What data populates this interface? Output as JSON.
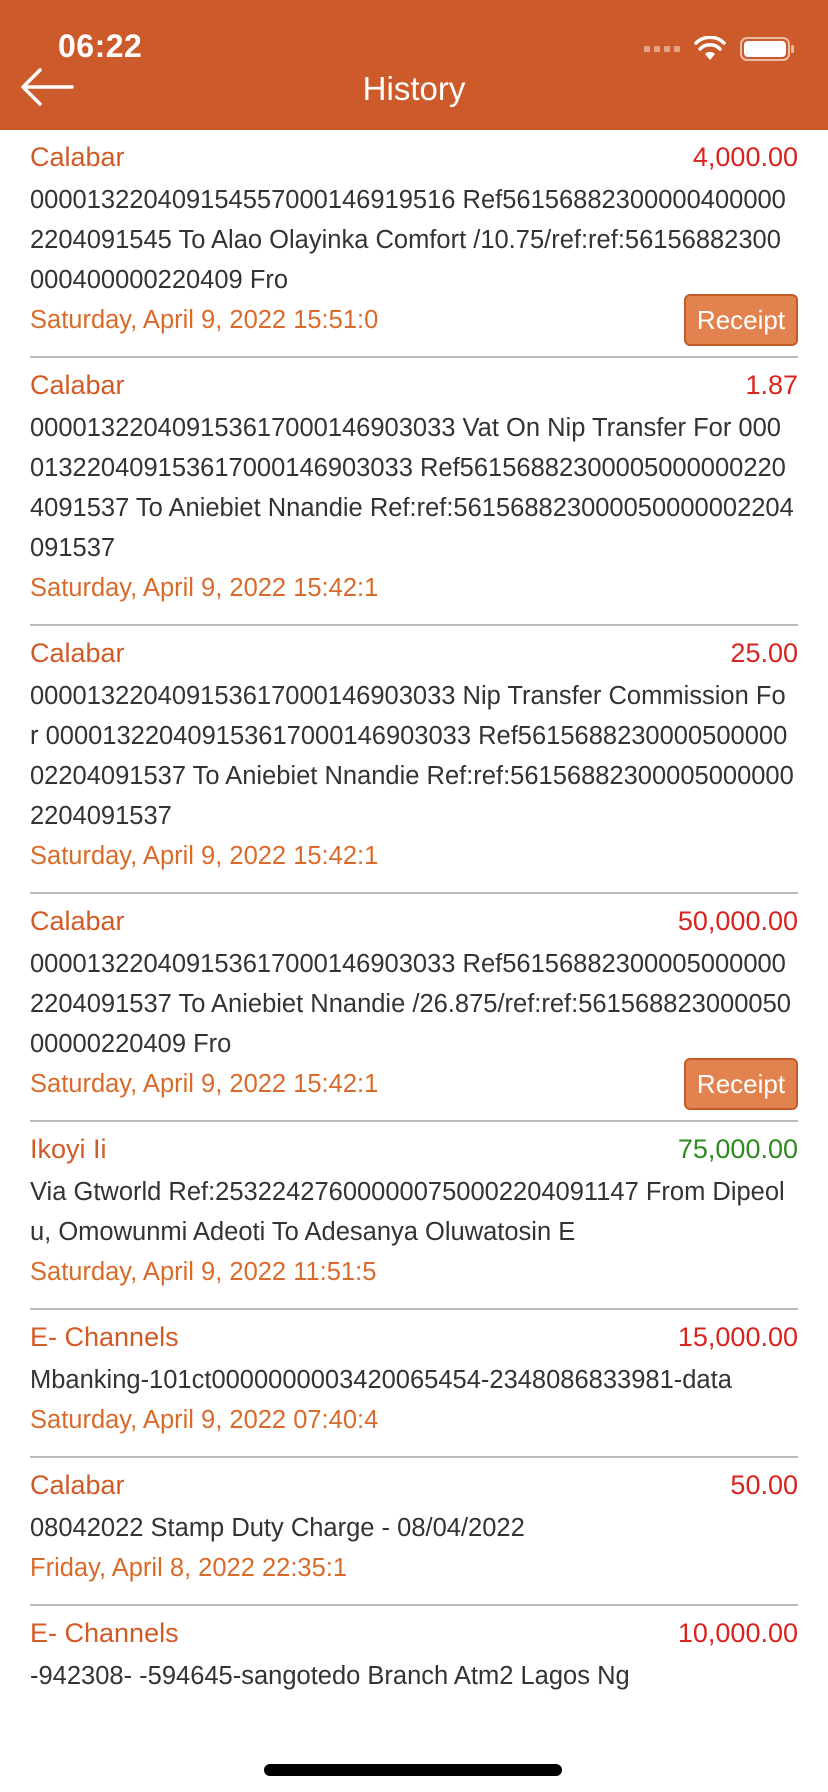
{
  "status_bar": {
    "time": "06:22"
  },
  "header": {
    "title": "History"
  },
  "colors": {
    "header_bg": "#cd5a2a",
    "branch": "#d25a25",
    "debit": "#d8241f",
    "credit": "#2e8a1e",
    "date": "#d96b2a",
    "receipt_bg": "#e2824e"
  },
  "transactions": [
    {
      "branch": "Calabar",
      "amount": "4,000.00",
      "type": "debit",
      "description": "000013220409154557000146919516 Ref561568823000004000002204091545 To Alao Olayinka Comfort /10.75/ref:ref:56156882300000400000220409 Fro",
      "date": "Saturday, April 9, 2022 15:51:0",
      "receipt_label": "Receipt"
    },
    {
      "branch": "Calabar",
      "amount": "1.87",
      "type": "debit",
      "description": "000013220409153617000146903033 Vat On Nip Transfer For 000013220409153617000146903033 Ref561568823000050000002204091537 To Aniebiet Nnandie Ref:ref:561568823000050000002204091537",
      "date": "Saturday, April 9, 2022 15:42:1"
    },
    {
      "branch": "Calabar",
      "amount": "25.00",
      "type": "debit",
      "description": "000013220409153617000146903033 Nip Transfer Commission For 000013220409153617000146903033 Ref561568823000050000002204091537 To Aniebiet Nnandie Ref:ref:561568823000050000002204091537",
      "date": "Saturday, April 9, 2022 15:42:1"
    },
    {
      "branch": "Calabar",
      "amount": "50,000.00",
      "type": "debit",
      "description": "000013220409153617000146903033 Ref561568823000050000002204091537 To Aniebiet Nnandie /26.875/ref:ref:56156882300005000000220409 Fro",
      "date": "Saturday, April 9, 2022 15:42:1",
      "receipt_label": "Receipt"
    },
    {
      "branch": "Ikoyi Ii",
      "amount": "75,000.00",
      "type": "credit",
      "description": "Via Gtworld Ref:253224276000000750002204091147 From Dipeolu, Omowunmi Adeoti To Adesanya Oluwatosin E",
      "date": "Saturday, April 9, 2022 11:51:5"
    },
    {
      "branch": "E- Channels",
      "amount": "15,000.00",
      "type": "debit",
      "description": "Mbanking-101ct000000000342006545­4-2348086833981-data",
      "date": "Saturday, April 9, 2022 07:40:4"
    },
    {
      "branch": "Calabar",
      "amount": "50.00",
      "type": "debit",
      "description": "08042022 Stamp Duty Charge - 08/04/2022",
      "date": "Friday, April 8, 2022 22:35:1"
    },
    {
      "branch": "E- Channels",
      "amount": "10,000.00",
      "type": "debit",
      "description": "-942308- -594645-sangotedo Branch Atm2 Lagos Ng",
      "date": ""
    }
  ]
}
